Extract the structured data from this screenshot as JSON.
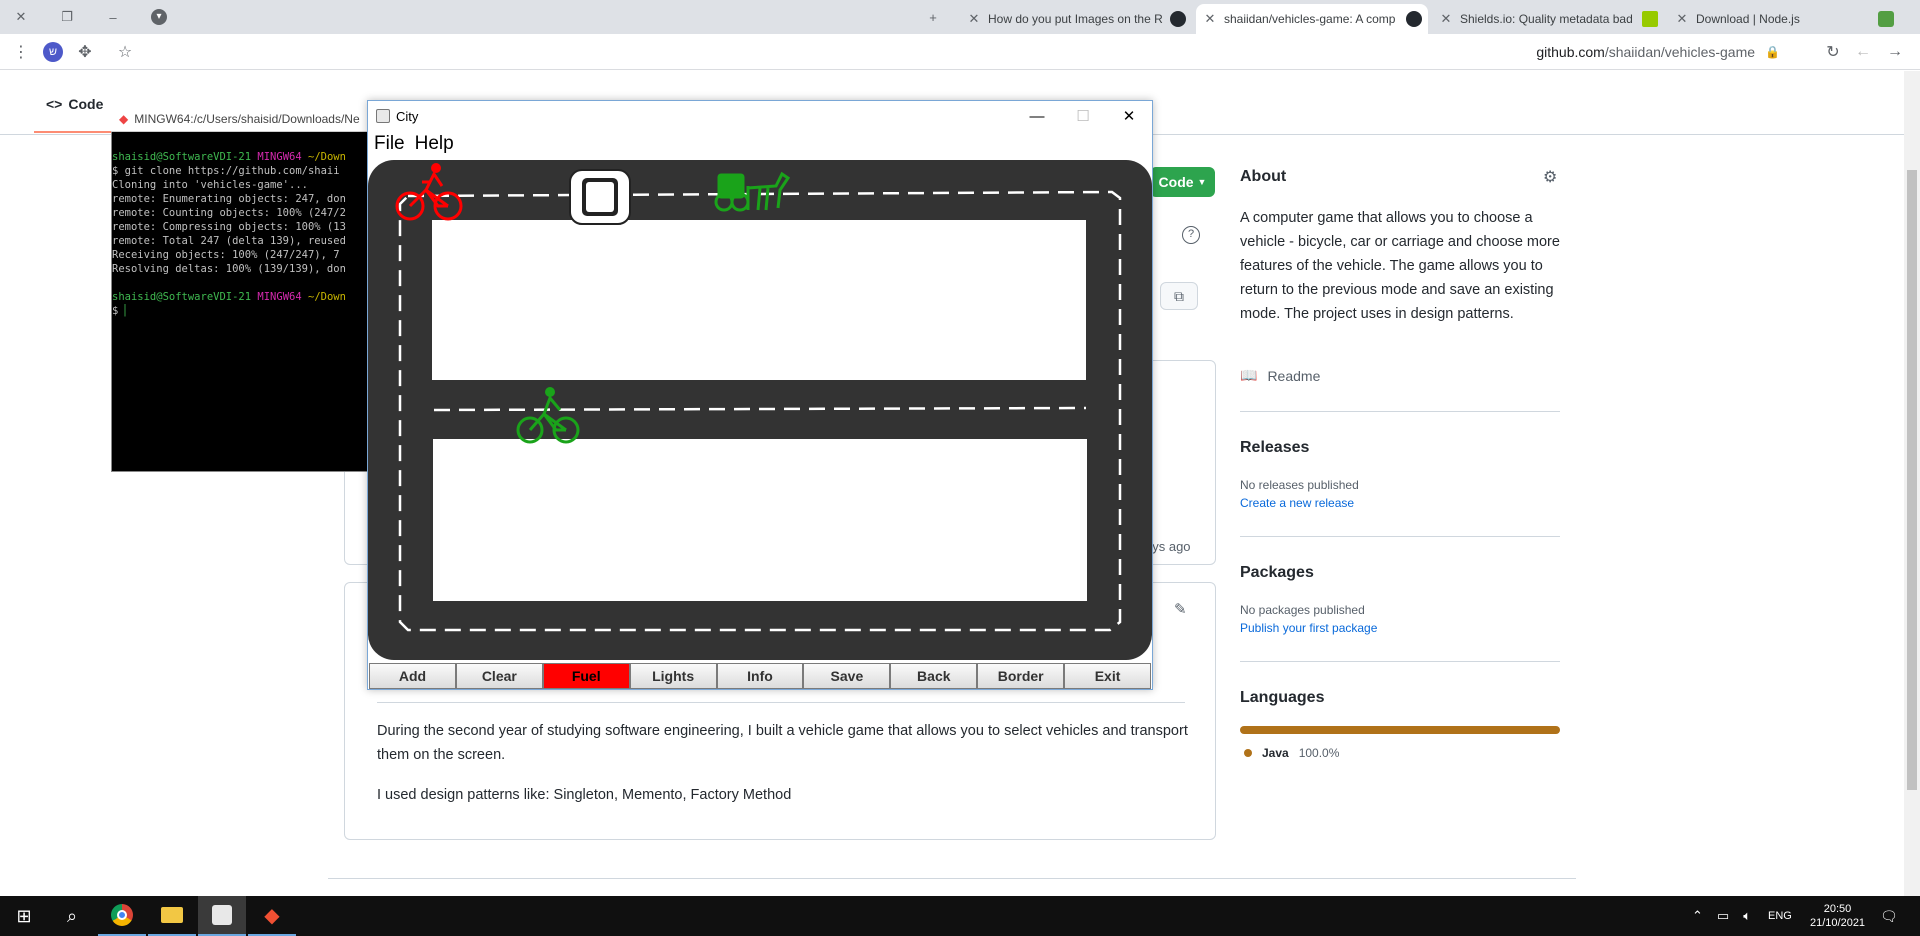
{
  "browser": {
    "tabs": [
      {
        "title": "How do you put Images on the R",
        "active": false
      },
      {
        "title": "shaiidan/vehicles-game: A comp",
        "active": true
      },
      {
        "title": "Shields.io: Quality metadata bad",
        "active": false
      },
      {
        "title": "Download | Node.js",
        "active": false
      }
    ],
    "url_host": "github.com",
    "url_path": "/shaiidan/vehicles-game"
  },
  "github": {
    "code_tab": "Code",
    "code_button": "Code",
    "files_age": "ays ago",
    "about": {
      "heading": "About",
      "description": "A computer game that allows you to choose a vehicle - bicycle, car or carriage and choose more features of the vehicle. The game allows you to return to the previous mode and save an existing mode. The project uses in design patterns.",
      "readme_link": "Readme"
    },
    "releases": {
      "heading": "Releases",
      "none": "No releases published",
      "link": "Create a new release"
    },
    "packages": {
      "heading": "Packages",
      "none": "No packages published",
      "link": "Publish your first package"
    },
    "languages": {
      "heading": "Languages",
      "name": "Java",
      "percent": "100.0%",
      "color": "#b07219"
    },
    "readme": {
      "p1": "During the second year of studying software engineering, I built a vehicle game that allows you to select vehicles and transport them on the screen.",
      "p2": "I used design patterns like: Singleton, Memento, Factory Method"
    }
  },
  "terminal": {
    "title": "MINGW64:/c/Users/shaisid/Downloads/Ne",
    "prompt_user": "shaisid@SoftwareVDI-21",
    "prompt_env": "MINGW64",
    "prompt_path": "~/Down",
    "lines": [
      "$ git clone https://github.com/shaii",
      "Cloning into 'vehicles-game'...",
      "remote: Enumerating objects: 247, don",
      "remote: Counting objects: 100% (247/2",
      "remote: Compressing objects: 100% (13",
      "remote: Total 247 (delta 139), reused",
      "Receiving objects: 100% (247/247), 7",
      "Resolving deltas: 100% (139/139), don"
    ],
    "cursor_line": "$ "
  },
  "city_window": {
    "title": "City",
    "menu": [
      "File",
      "Help"
    ],
    "buttons": [
      {
        "label": "Add",
        "highlight": false
      },
      {
        "label": "Clear",
        "highlight": false
      },
      {
        "label": "Fuel",
        "highlight": true
      },
      {
        "label": "Lights",
        "highlight": false
      },
      {
        "label": "Info",
        "highlight": false
      },
      {
        "label": "Save",
        "highlight": false
      },
      {
        "label": "Back",
        "highlight": false
      },
      {
        "label": "Border",
        "highlight": false
      },
      {
        "label": "Exit",
        "highlight": false
      }
    ],
    "vehicles": [
      {
        "type": "bicycle",
        "color": "#ff0000"
      },
      {
        "type": "car",
        "color": "#ffffff"
      },
      {
        "type": "carriage",
        "color": "#1aa31a"
      },
      {
        "type": "bicycle",
        "color": "#1aa31a"
      }
    ]
  },
  "taskbar": {
    "language": "ENG",
    "time": "20:50",
    "date": "21/10/2021"
  }
}
